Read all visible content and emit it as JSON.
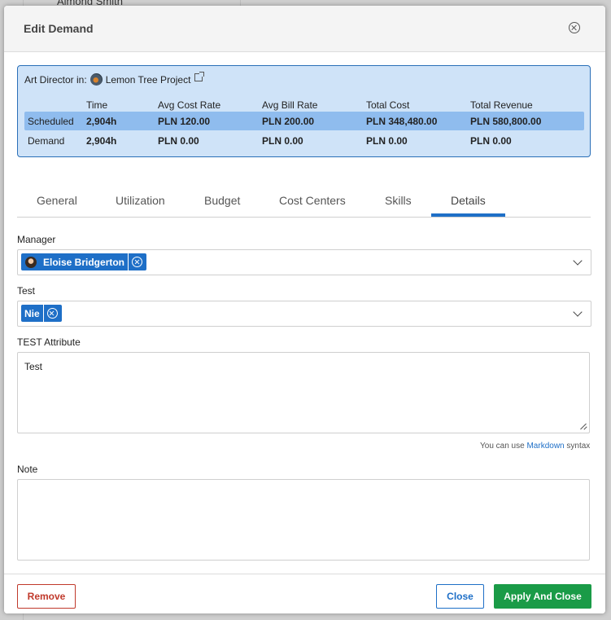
{
  "background": {
    "partial_text": "Almond Smith"
  },
  "modal": {
    "title": "Edit Demand"
  },
  "summary": {
    "role_prefix": "Art Director in:",
    "project_name": "Lemon Tree Project",
    "headers": [
      "",
      "Time",
      "Avg Cost Rate",
      "Avg Bill Rate",
      "Total Cost",
      "Total Revenue"
    ],
    "rows": [
      {
        "label": "Scheduled",
        "time": "2,904h",
        "avg_cost_rate": "PLN 120.00",
        "avg_bill_rate": "PLN 200.00",
        "total_cost": "PLN 348,480.00",
        "total_revenue": "PLN 580,800.00"
      },
      {
        "label": "Demand",
        "time": "2,904h",
        "avg_cost_rate": "PLN 0.00",
        "avg_bill_rate": "PLN 0.00",
        "total_cost": "PLN 0.00",
        "total_revenue": "PLN 0.00"
      }
    ]
  },
  "tabs": [
    {
      "label": "General"
    },
    {
      "label": "Utilization"
    },
    {
      "label": "Budget"
    },
    {
      "label": "Cost Centers"
    },
    {
      "label": "Skills"
    },
    {
      "label": "Details",
      "active": true
    }
  ],
  "fields": {
    "manager": {
      "label": "Manager",
      "value": "Eloise Bridgerton"
    },
    "test": {
      "label": "Test",
      "value": "Nie"
    },
    "test_attribute": {
      "label": "TEST Attribute",
      "value": "Test"
    },
    "markdown_hint": {
      "prefix": "You can use",
      "link": "Markdown",
      "suffix": "syntax"
    },
    "note": {
      "label": "Note",
      "value": ""
    }
  },
  "footer": {
    "remove_label": "Remove",
    "close_label": "Close",
    "apply_label": "Apply And Close"
  },
  "colors": {
    "accent": "#1e6fc7",
    "danger": "#c0392b",
    "success": "#1a9b47",
    "summary_bg": "#cfe3f8",
    "summary_highlight": "#8fbcee"
  }
}
